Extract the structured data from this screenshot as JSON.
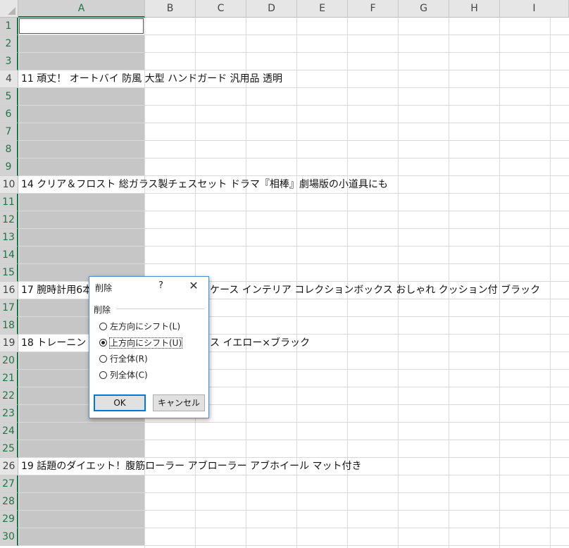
{
  "spreadsheet": {
    "columns": [
      "A",
      "B",
      "C",
      "D",
      "E",
      "F",
      "G",
      "H",
      "I"
    ],
    "rows": [
      "1",
      "2",
      "3",
      "4",
      "5",
      "6",
      "7",
      "8",
      "9",
      "10",
      "11",
      "12",
      "13",
      "14",
      "15",
      "16",
      "17",
      "18",
      "19",
      "20",
      "21",
      "22",
      "23",
      "24",
      "25",
      "26",
      "27",
      "28",
      "29",
      "30"
    ],
    "cells": {
      "r4": "11 頑丈！ オートバイ 防風 大型 ハンドガード 汎用品 透明",
      "r10": "14 クリア＆フロスト 総ガラス製チェスセット ドラマ『相棒』劇場版の小道具にも",
      "r16a": "17 腕時計用6本",
      "r16b": "ケース インテリア コレクションボックス おしゃれ クッション付 ブラック",
      "r19a": "18 トレーニン",
      "r19b": "ス イエロー×ブラック",
      "r26": "19 話題のダイエット！腹筋ローラー アブローラー アブホイール マット付き"
    }
  },
  "dialog": {
    "title": "削除",
    "help": "?",
    "close": "✕",
    "group_label": "削除",
    "options": [
      {
        "label": "左方向にシフト(L)",
        "selected": false
      },
      {
        "label": "上方向にシフト(U)",
        "selected": true
      },
      {
        "label": "行全体(R)",
        "selected": false
      },
      {
        "label": "列全体(C)",
        "selected": false
      }
    ],
    "ok_label": "OK",
    "cancel_label": "キャンセル"
  }
}
